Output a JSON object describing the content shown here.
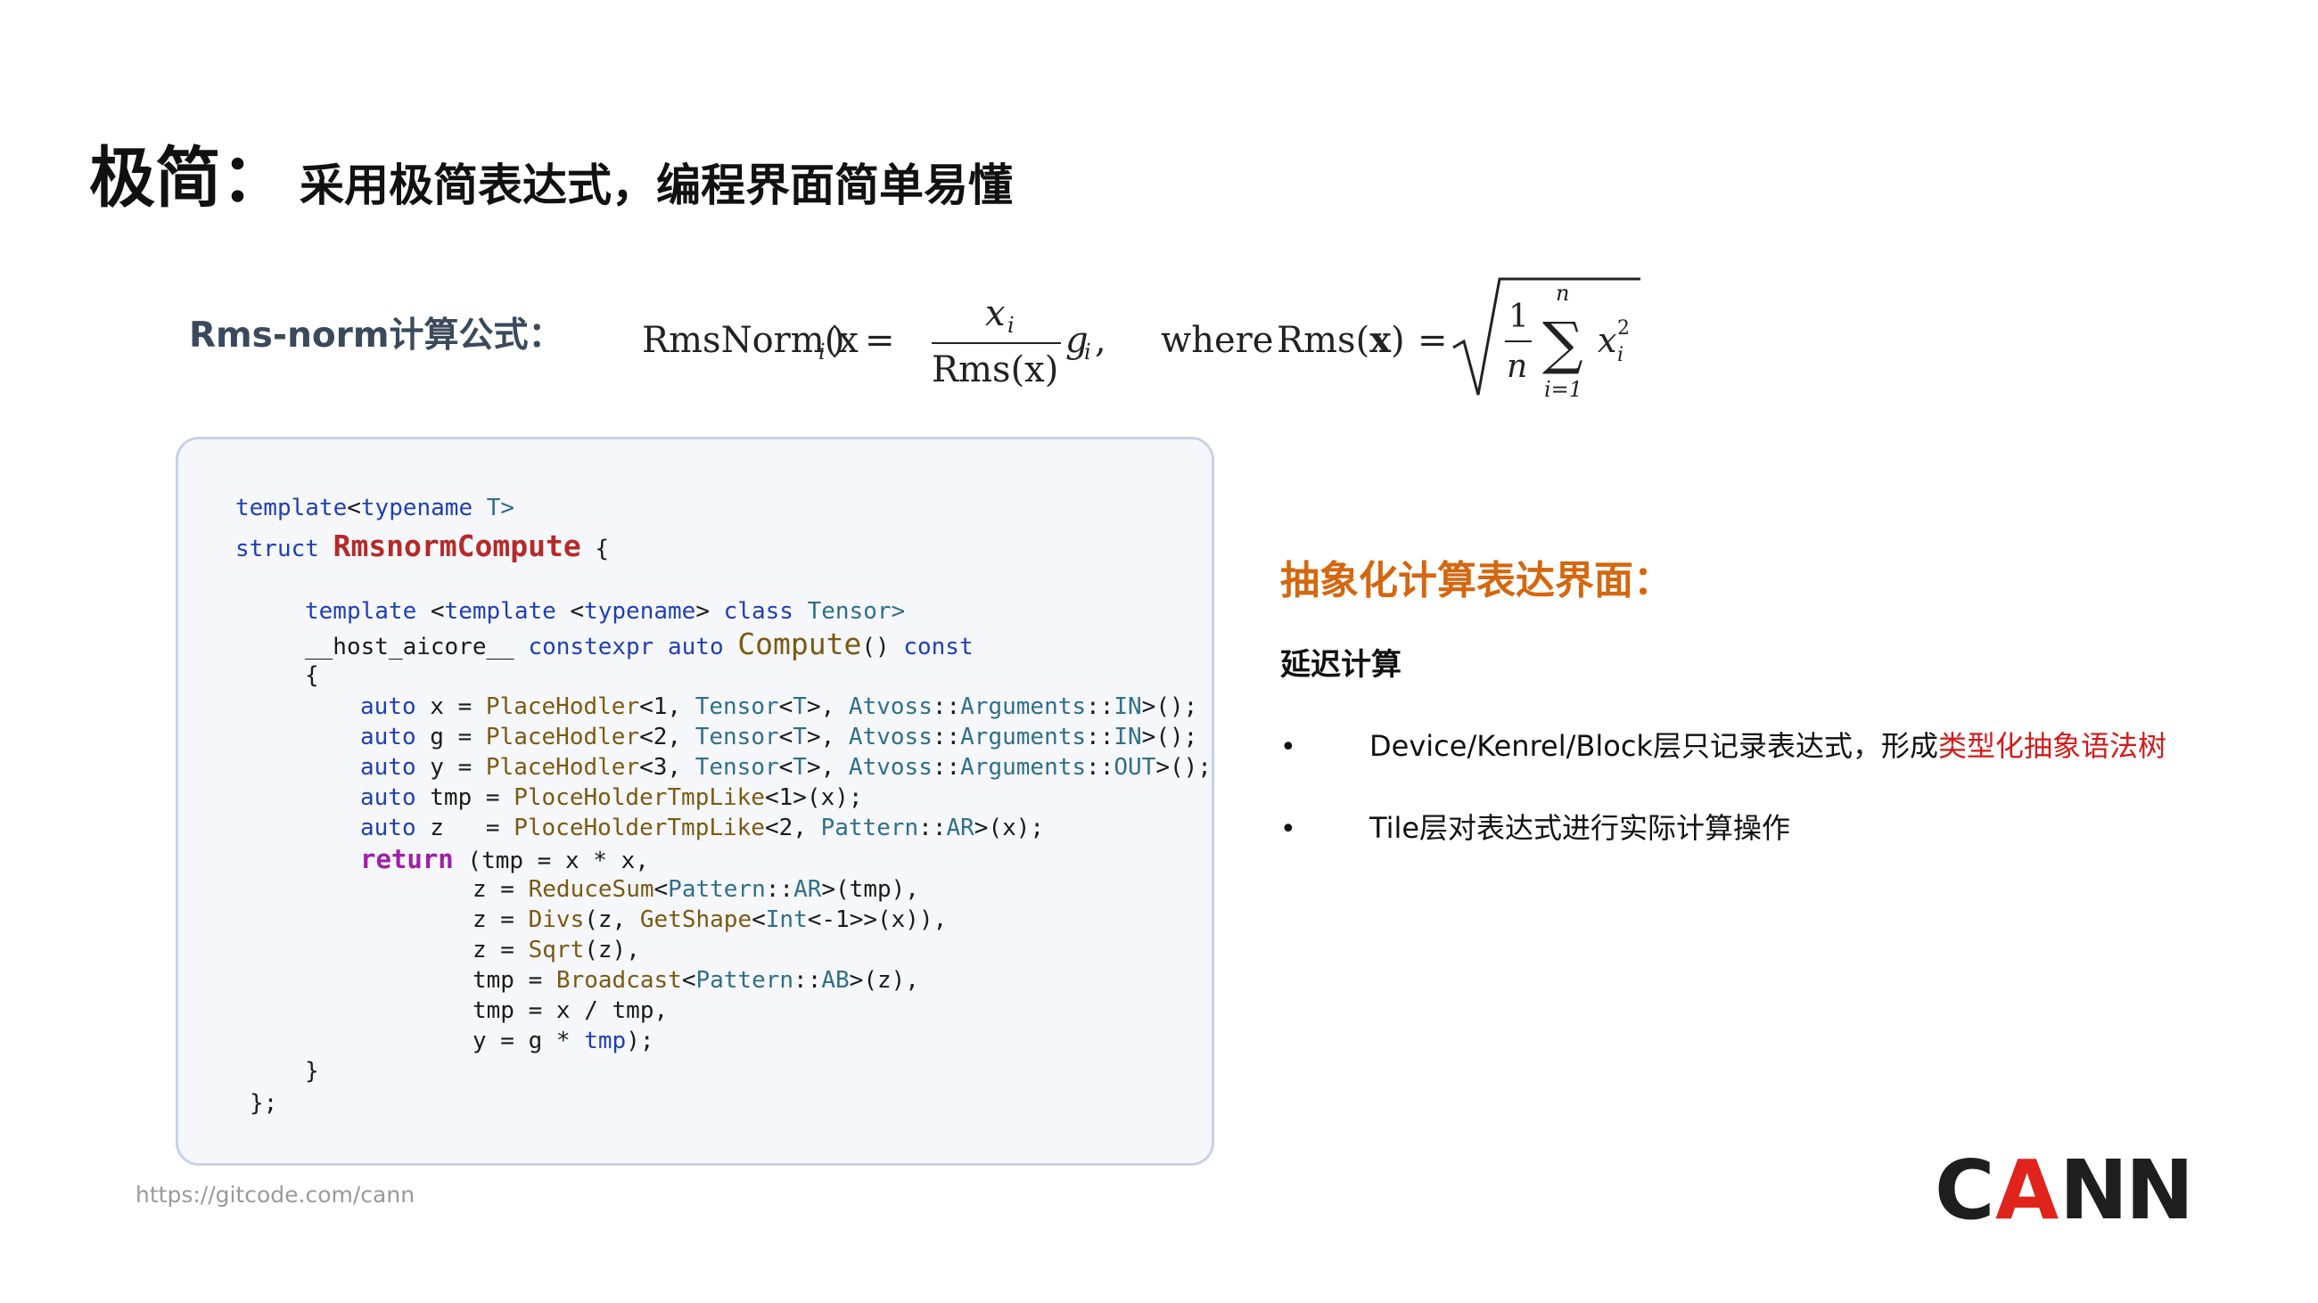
{
  "title": {
    "main": "极简：",
    "subtitle": "采用极简表达式，编程界面简单易懂"
  },
  "formula": {
    "label": "Rms-norm计算公式：",
    "lhs": "RmsNorm(x",
    "frac_num": "x",
    "frac_den": "Rms(x)",
    "gi": "g",
    "where": "where",
    "rms": "Rms(",
    "sum_top": "n",
    "sum_bottom": "i=1",
    "one": "1",
    "n_den": "n",
    "sub_i": "i",
    "sup_2": "2"
  },
  "code": {
    "l1": [
      "template",
      "<",
      "typename",
      " T>"
    ],
    "l2": [
      "struct ",
      "RmsnormCompute",
      " {"
    ],
    "l3": [
      "template",
      " <",
      "template",
      " <",
      "typename",
      "> ",
      "class",
      " Tensor>"
    ],
    "l4": [
      "__host_aicore__ ",
      "constexpr",
      " ",
      "auto",
      " ",
      "Compute",
      "() ",
      "const"
    ],
    "l5": "{",
    "l6": [
      "auto",
      " x = ",
      "PlaceHodler",
      "<1, ",
      "Tensor",
      "<",
      "T",
      ">, ",
      "Atvoss",
      "::",
      "Arguments",
      "::",
      "IN",
      ">();"
    ],
    "l7": [
      "auto",
      " g = ",
      "PlaceHodler",
      "<2, ",
      "Tensor",
      "<",
      "T",
      ">, ",
      "Atvoss",
      "::",
      "Arguments",
      "::",
      "IN",
      ">();"
    ],
    "l8": [
      "auto",
      " y = ",
      "PlaceHodler",
      "<3, ",
      "Tensor",
      "<",
      "T",
      ">, ",
      "Atvoss",
      "::",
      "Arguments",
      "::",
      "OUT",
      ">();"
    ],
    "l9": [
      "auto",
      " tmp = ",
      "PloceHolderTmpLike",
      "<1>(x);"
    ],
    "l10": [
      "auto",
      " z   = ",
      "PloceHolderTmpLike",
      "<2, ",
      "Pattern",
      "::",
      "AR",
      ">(x);"
    ],
    "l11": [
      "return",
      " (tmp = x * x,"
    ],
    "l12": [
      "z = ",
      "ReduceSum",
      "<",
      "Pattern",
      "::",
      "AR",
      ">(tmp),"
    ],
    "l13": [
      "z = ",
      "Divs",
      "(z, ",
      "GetShape",
      "<",
      "Int",
      "<-1>>(x)),"
    ],
    "l14": [
      "z = ",
      "Sqrt",
      "(z),"
    ],
    "l15": [
      "tmp = ",
      "Broadcast",
      "<",
      "Pattern",
      "::",
      "AB",
      ">(z),"
    ],
    "l16": "tmp = x / tmp,",
    "l17": [
      "y = g * ",
      "tmp",
      ");"
    ],
    "l18": "}",
    "l19": "};"
  },
  "right": {
    "heading": "抽象化计算表达界面：",
    "sub": "延迟计算",
    "bullet_symbol": "•",
    "b1_text": "Device/Kenrel/Block层只记录表达式，形成",
    "b1_red": "类型化抽象语法树",
    "b2_text": "Tile层对表达式进行实际计算操作"
  },
  "footer": {
    "url": "https://gitcode.com/cann"
  },
  "logo": {
    "text": "CANN",
    "colors": {
      "dark": "#1e1e1e",
      "red": "#e0231c"
    }
  }
}
